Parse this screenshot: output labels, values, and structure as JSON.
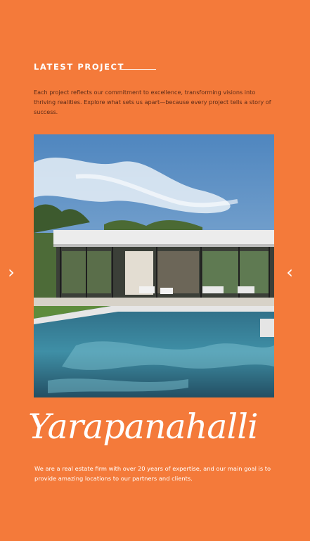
{
  "section": {
    "title": "LATEST PROJECT",
    "intro": "Each project reflects our commitment to excellence, transforming visions into thriving realities. Explore what sets us apart—because every project tells a story of success."
  },
  "carousel": {
    "next_icon": "chevron-right-icon",
    "prev_icon": "chevron-left-icon",
    "next_glyph": "›",
    "prev_glyph": "‹"
  },
  "project": {
    "name": "Yarapanahalli",
    "description": "We are a real estate firm with over 20 years of expertise, and our main goal is to provide amazing locations to our partners and clients."
  },
  "colors": {
    "background": "#F47A3A",
    "text": "#FFFFFF",
    "intro_text": "#5A2A17"
  }
}
